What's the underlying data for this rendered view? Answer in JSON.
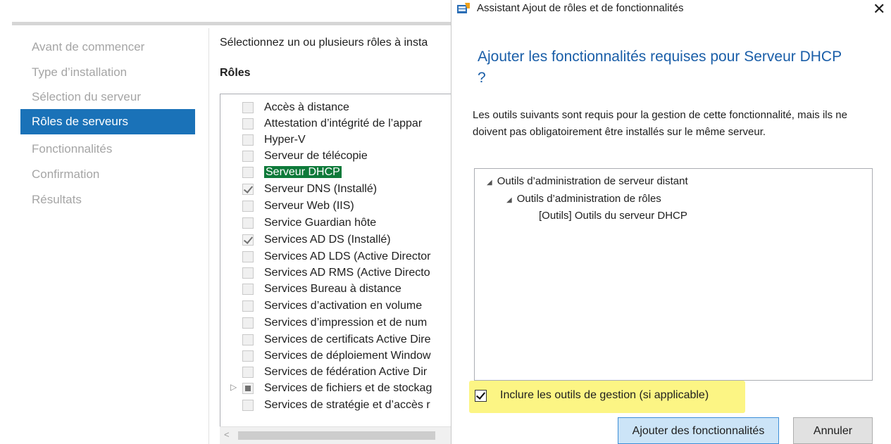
{
  "background_wizard": {
    "nav_items": [
      {
        "label": "Avant de commencer",
        "active": false
      },
      {
        "label": "Type d’installation",
        "active": false
      },
      {
        "label": "Sélection du serveur",
        "active": false
      },
      {
        "label": "Rôles de serveurs",
        "active": true
      },
      {
        "label": "Fonctionnalités",
        "active": false
      },
      {
        "label": "Confirmation",
        "active": false
      },
      {
        "label": "Résultats",
        "active": false
      }
    ],
    "intro_text": "Sélectionnez un ou plusieurs rôles à insta",
    "roles_title": "Rôles",
    "roles": [
      {
        "label": "Accès à distance",
        "state": "unchecked"
      },
      {
        "label": "Attestation d’intégrité de l’appar",
        "state": "unchecked"
      },
      {
        "label": "Hyper-V",
        "state": "unchecked"
      },
      {
        "label": "Serveur de télécopie",
        "state": "unchecked"
      },
      {
        "label": "Serveur DHCP",
        "state": "unchecked",
        "selected": true
      },
      {
        "label": "Serveur DNS (Installé)",
        "state": "checked"
      },
      {
        "label": "Serveur Web (IIS)",
        "state": "unchecked"
      },
      {
        "label": "Service Guardian hôte",
        "state": "unchecked"
      },
      {
        "label": "Services AD DS (Installé)",
        "state": "checked"
      },
      {
        "label": "Services AD LDS (Active Director",
        "state": "unchecked"
      },
      {
        "label": "Services AD RMS (Active Directo",
        "state": "unchecked"
      },
      {
        "label": "Services Bureau à distance",
        "state": "unchecked"
      },
      {
        "label": "Services d’activation en volume",
        "state": "unchecked"
      },
      {
        "label": "Services d’impression et de num",
        "state": "unchecked"
      },
      {
        "label": "Services de certificats Active Dire",
        "state": "unchecked"
      },
      {
        "label": "Services de déploiement Window",
        "state": "unchecked"
      },
      {
        "label": "Services de fédération Active Dir",
        "state": "unchecked"
      },
      {
        "label": "Services de fichiers et de stockag",
        "state": "partial",
        "expandable": true
      },
      {
        "label": "Services de stratégie et d’accès r",
        "state": "unchecked"
      }
    ],
    "scroll_left_arrow": "<"
  },
  "dialog": {
    "title": "Assistant Ajout de rôles et de fonctionnalités",
    "close_glyph": "✕",
    "heading": "Ajouter les fonctionnalités requises pour Serveur DHCP ?",
    "description": "Les outils suivants sont requis pour la gestion de cette fonctionnalité, mais ils ne doivent pas obligatoirement être installés sur le même serveur.",
    "tree": [
      {
        "label": "Outils d’administration de serveur distant",
        "expanded": true
      },
      {
        "label": "Outils d’administration de rôles",
        "expanded": true
      },
      {
        "label": "[Outils] Outils du serveur DHCP"
      }
    ],
    "include_tools_label": "Inclure les outils de gestion (si applicable)",
    "include_tools_checked": true,
    "add_button_label": "Ajouter des fonctionnalités",
    "cancel_button_label": "Annuler"
  },
  "colors": {
    "active_nav": "#1a72b8",
    "heading_blue": "#1a5ea8",
    "highlight_yellow": "#fbf25b",
    "primary_button": "#cce4f7"
  }
}
